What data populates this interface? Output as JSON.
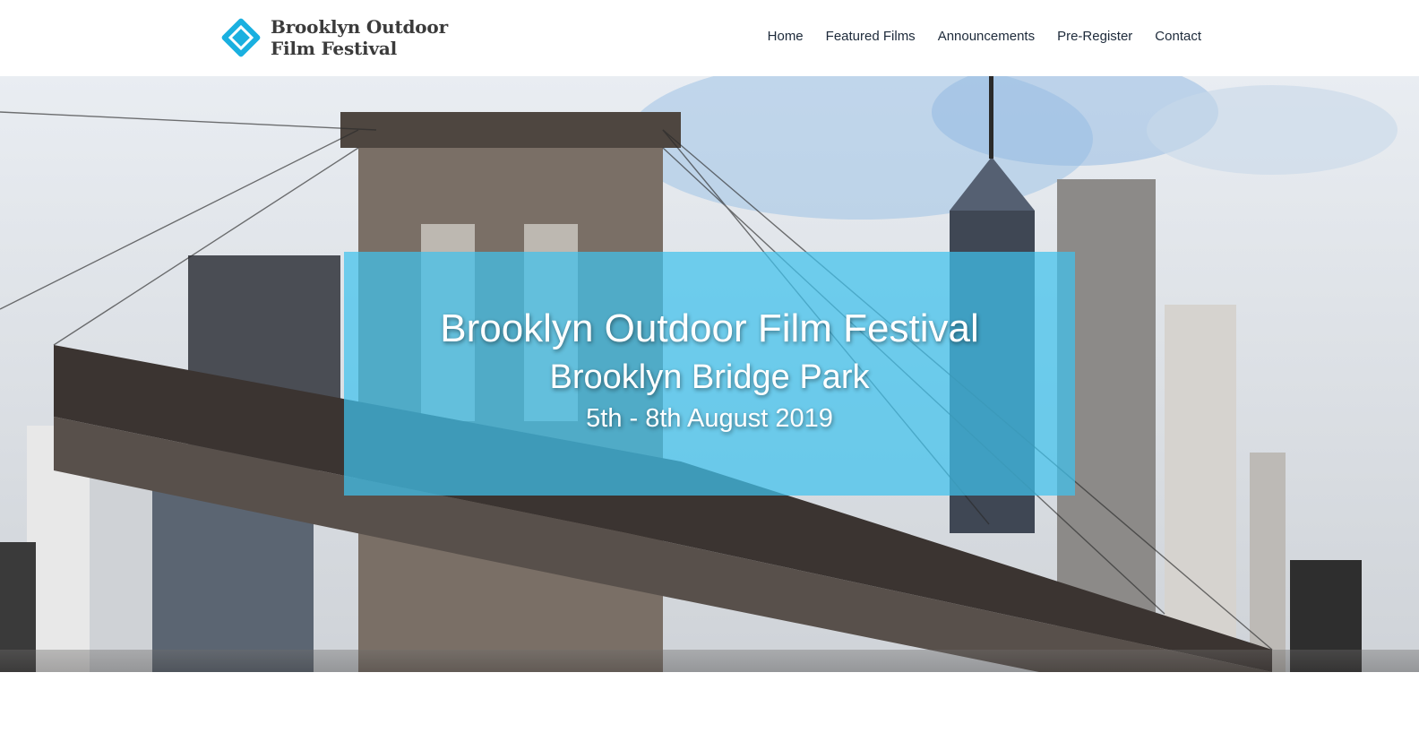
{
  "brand": {
    "logo_line1": "Brooklyn Outdoor",
    "logo_line2": "Film Festival",
    "logo_icon": "film-ticket-icon",
    "accent_color": "#1ab0e0"
  },
  "nav": {
    "items": [
      {
        "label": "Home"
      },
      {
        "label": "Featured Films"
      },
      {
        "label": "Announcements"
      },
      {
        "label": "Pre-Register"
      },
      {
        "label": "Contact"
      }
    ]
  },
  "hero": {
    "title": "Brooklyn Outdoor Film Festival",
    "subtitle": "Brooklyn Bridge Park",
    "dates": "5th - 8th August 2019",
    "overlay_color": "#40c2ed",
    "background_image": "brooklyn-bridge-skyline-illustration"
  }
}
